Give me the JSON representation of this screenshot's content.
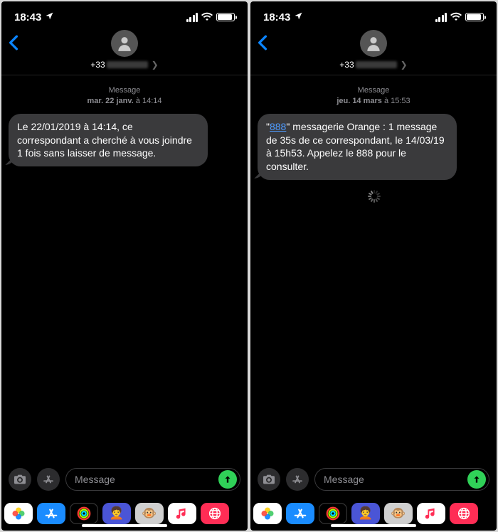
{
  "screens": [
    {
      "status": {
        "time": "18:43"
      },
      "header": {
        "phone_prefix": "+33"
      },
      "ts": {
        "label": "Message",
        "datePrefix": "mar. 22 janv.",
        "at": " à 14:14"
      },
      "bubble": {
        "text": "Le 22/01/2019 à 14:14, ce correspondant a cherché à vous joindre 1 fois sans laisser de message."
      },
      "spinner": false,
      "input": {
        "placeholder": "Message"
      }
    },
    {
      "status": {
        "time": "18:43"
      },
      "header": {
        "phone_prefix": "+33"
      },
      "ts": {
        "label": "Message",
        "datePrefix": "jeu. 14 mars",
        "at": " à 15:53"
      },
      "bubble": {
        "link888": "888",
        "prefix": "\"",
        "suffix": "\" messagerie Orange : 1 message de 35s de ce correspondant, le 14/03/19 à 15h53. Appelez le 888 pour le consulter."
      },
      "spinner": true,
      "input": {
        "placeholder": "Message"
      }
    }
  ],
  "apps": [
    "photos",
    "store",
    "fitness",
    "memoji1",
    "memoji2",
    "music",
    "web"
  ]
}
